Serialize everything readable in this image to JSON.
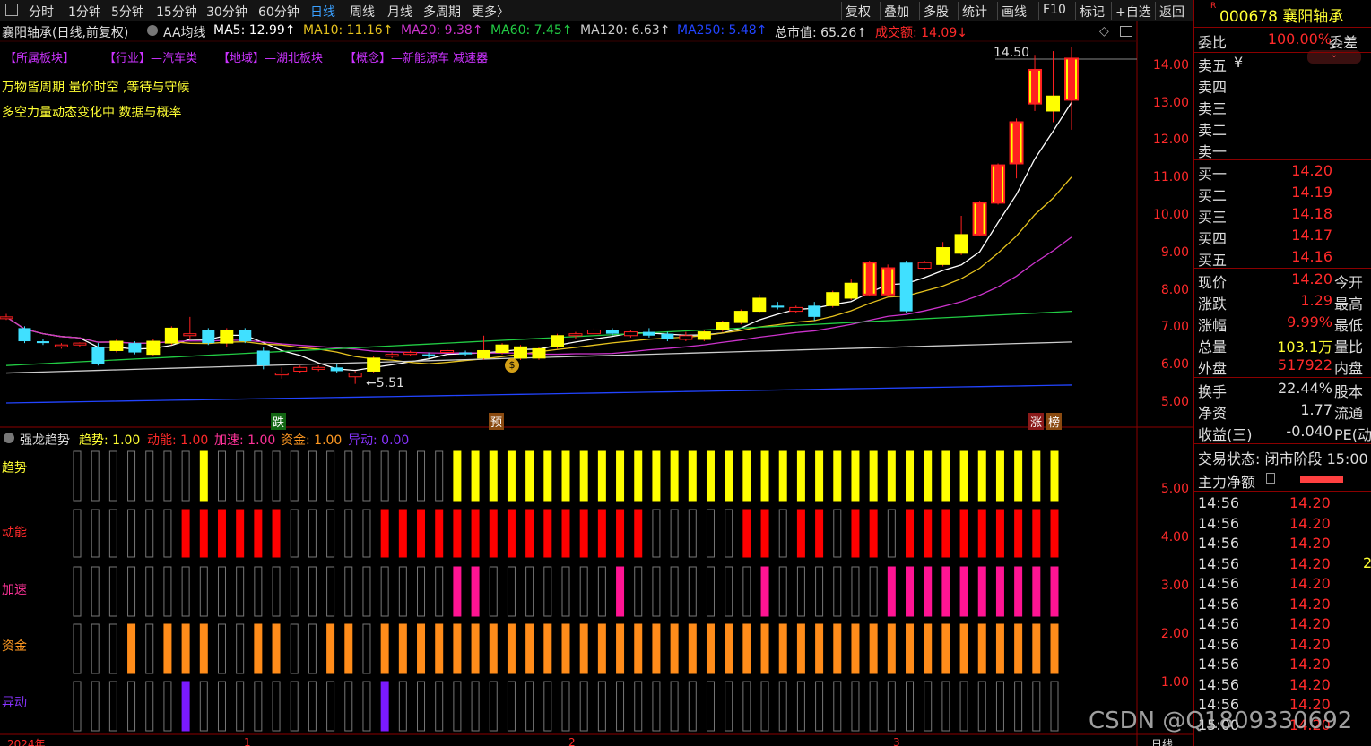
{
  "toolbar": {
    "left": [
      "分时",
      "1分钟",
      "5分钟",
      "15分钟",
      "30分钟",
      "60分钟",
      "日线",
      "周线",
      "月线",
      "多周期",
      "更多〉"
    ],
    "right": [
      "复权",
      "叠加",
      "多股",
      "统计",
      "画线",
      "F10",
      "标记",
      "+自选",
      "返回"
    ]
  },
  "header": {
    "title": "襄阳轴承(日线,前复权)",
    "ma_label": "AA均线",
    "ma5": "MA5: 12.99↑",
    "ma10": "MA10: 11.16↑",
    "ma20": "MA20: 9.38↑",
    "ma60": "MA60: 7.45↑",
    "ma120": "MA120: 6.63↑",
    "ma250": "MA250: 5.48↑",
    "mktcap": "总市值: 65.26↑",
    "amount": "成交额: 14.09↓"
  },
  "tags": [
    "【所属板块】",
    "【行业】—汽车类",
    "【地域】—湖北板块",
    "【概念】—新能源车 减速器"
  ],
  "notes": [
    "万物皆周期  量价时空  ,等待与守候",
    "多空力量动态变化中 数据与概率"
  ],
  "labels": {
    "high": "14.50",
    "low": "←5.51",
    "die": "跌",
    "yu": "预",
    "zhang": "涨",
    "bang": "榜"
  },
  "price_axis": [
    "14.00",
    "13.00",
    "12.00",
    "11.00",
    "10.00",
    "9.00",
    "8.00",
    "7.00",
    "6.00",
    "5.00"
  ],
  "indicator": {
    "header_name": "强龙趋势",
    "v_trend": "趋势: 1.00",
    "v_energy": "动能: 1.00",
    "v_accel": "加速: 1.00",
    "v_fund": "资金: 1.00",
    "v_abn": "异动: 0.00",
    "rows": [
      "趋势",
      "动能",
      "加速",
      "资金",
      "异动"
    ],
    "axis": [
      "5.00",
      "4.00",
      "3.00",
      "2.00",
      "1.00"
    ]
  },
  "bottom": {
    "year": "2024年",
    "m1": "1",
    "m2": "2",
    "m3": "3",
    "period": "日线"
  },
  "panel": {
    "code": "000678 襄阳轴承",
    "weibi_label": "委比",
    "weibi_val": "100.00%",
    "weicha": "委差",
    "sells": [
      "卖五",
      "卖四",
      "卖三",
      "卖二",
      "卖一"
    ],
    "buys": [
      {
        "l": "买一",
        "v": "14.20"
      },
      {
        "l": "买二",
        "v": "14.19"
      },
      {
        "l": "买三",
        "v": "14.18"
      },
      {
        "l": "买四",
        "v": "14.17"
      },
      {
        "l": "买五",
        "v": "14.16"
      }
    ],
    "stats": [
      {
        "l": "现价",
        "v": "14.20",
        "s": "今开"
      },
      {
        "l": "涨跌",
        "v": "1.29",
        "s": "最高"
      },
      {
        "l": "涨幅",
        "v": "9.99%",
        "s": "最低"
      },
      {
        "l": "总量",
        "v": "103.1万",
        "s": "量比"
      },
      {
        "l": "外盘",
        "v": "517922",
        "s": "内盘"
      }
    ],
    "stats2": [
      {
        "l": "换手",
        "v": "22.44%",
        "s": "股本"
      },
      {
        "l": "净资",
        "v": "1.77",
        "s": "流通"
      },
      {
        "l": "收益(三)",
        "v": "-0.040",
        "s": "PE(动"
      }
    ],
    "status": "交易状态: 闭市阶段 15:00",
    "flow": "主力净额",
    "ticks": [
      "14:56",
      "14:56",
      "14:56",
      "14:56",
      "14:56",
      "14:56",
      "14:56",
      "14:56",
      "14:56",
      "14:56",
      "14:56",
      "15:00"
    ],
    "tick_price": "14.20",
    "tick_extra": "2"
  },
  "watermark": "CSDN @Q1809330692",
  "colors": {
    "up": "#ff2020",
    "upfill": "#ffff00",
    "down": "#40e0ff",
    "ma5": "#ffffff",
    "ma10": "#e6c21e",
    "ma20": "#cc33cc",
    "ma60": "#22cc44",
    "ma120": "#cccccc",
    "ma250": "#2244ff"
  },
  "chart_data": {
    "type": "candlestick",
    "ohlc": [
      [
        7.3,
        7.38,
        7.22,
        7.3
      ],
      [
        7.0,
        7.05,
        6.6,
        6.65
      ],
      [
        6.65,
        6.7,
        6.55,
        6.6
      ],
      [
        6.55,
        6.6,
        6.45,
        6.55
      ],
      [
        6.55,
        6.62,
        6.5,
        6.6
      ],
      [
        6.5,
        6.6,
        6.0,
        6.05
      ],
      [
        6.4,
        6.7,
        6.35,
        6.65
      ],
      [
        6.6,
        6.65,
        6.3,
        6.35
      ],
      [
        6.3,
        6.7,
        6.25,
        6.65
      ],
      [
        6.6,
        7.05,
        6.55,
        7.0
      ],
      [
        6.8,
        7.3,
        6.7,
        6.85
      ],
      [
        6.95,
        7.0,
        6.55,
        6.6
      ],
      [
        6.6,
        7.0,
        6.5,
        6.95
      ],
      [
        6.95,
        7.0,
        6.6,
        6.65
      ],
      [
        6.4,
        6.5,
        5.9,
        6.0
      ],
      [
        5.75,
        5.95,
        5.65,
        5.8
      ],
      [
        5.85,
        6.0,
        5.8,
        5.95
      ],
      [
        5.9,
        6.0,
        5.85,
        5.95
      ],
      [
        5.95,
        6.05,
        5.8,
        5.85
      ],
      [
        5.7,
        5.85,
        5.51,
        5.8
      ],
      [
        5.85,
        6.25,
        5.8,
        6.2
      ],
      [
        6.25,
        6.35,
        6.2,
        6.3
      ],
      [
        6.3,
        6.4,
        6.25,
        6.35
      ],
      [
        6.3,
        6.35,
        6.2,
        6.25
      ],
      [
        6.35,
        6.45,
        6.25,
        6.4
      ],
      [
        6.35,
        6.4,
        6.25,
        6.3
      ],
      [
        6.2,
        6.8,
        6.15,
        6.4
      ],
      [
        6.35,
        6.6,
        6.3,
        6.55
      ],
      [
        6.2,
        6.55,
        6.15,
        6.5
      ],
      [
        6.2,
        6.5,
        6.15,
        6.45
      ],
      [
        6.5,
        6.85,
        6.45,
        6.8
      ],
      [
        6.8,
        6.9,
        6.7,
        6.85
      ],
      [
        6.85,
        7.0,
        6.8,
        6.95
      ],
      [
        6.95,
        7.0,
        6.8,
        6.85
      ],
      [
        6.8,
        6.95,
        6.75,
        6.9
      ],
      [
        6.9,
        7.0,
        6.75,
        6.8
      ],
      [
        6.85,
        6.9,
        6.65,
        6.7
      ],
      [
        6.7,
        6.9,
        6.65,
        6.8
      ],
      [
        6.7,
        6.95,
        6.65,
        6.9
      ],
      [
        6.95,
        7.2,
        6.9,
        7.15
      ],
      [
        7.15,
        7.5,
        7.1,
        7.45
      ],
      [
        7.45,
        7.9,
        7.4,
        7.8
      ],
      [
        7.6,
        7.7,
        7.5,
        7.55
      ],
      [
        7.45,
        7.6,
        7.4,
        7.55
      ],
      [
        7.6,
        7.7,
        7.2,
        7.3
      ],
      [
        7.6,
        8.0,
        7.55,
        7.95
      ],
      [
        7.8,
        8.3,
        7.75,
        8.2
      ],
      [
        7.9,
        8.8,
        7.85,
        8.75
      ],
      [
        7.9,
        8.7,
        7.85,
        8.6
      ],
      [
        8.75,
        8.8,
        7.4,
        7.45
      ],
      [
        8.6,
        8.8,
        8.55,
        8.75
      ],
      [
        8.7,
        9.3,
        8.65,
        9.15
      ],
      [
        9.0,
        10.0,
        8.95,
        9.5
      ],
      [
        9.5,
        10.4,
        9.45,
        10.35
      ],
      [
        10.35,
        11.4,
        10.3,
        11.35
      ],
      [
        11.4,
        12.6,
        11.0,
        12.5
      ],
      [
        13.0,
        14.3,
        12.8,
        13.9
      ],
      [
        12.8,
        14.4,
        12.5,
        13.2
      ],
      [
        13.1,
        14.5,
        12.3,
        14.2
      ]
    ]
  }
}
